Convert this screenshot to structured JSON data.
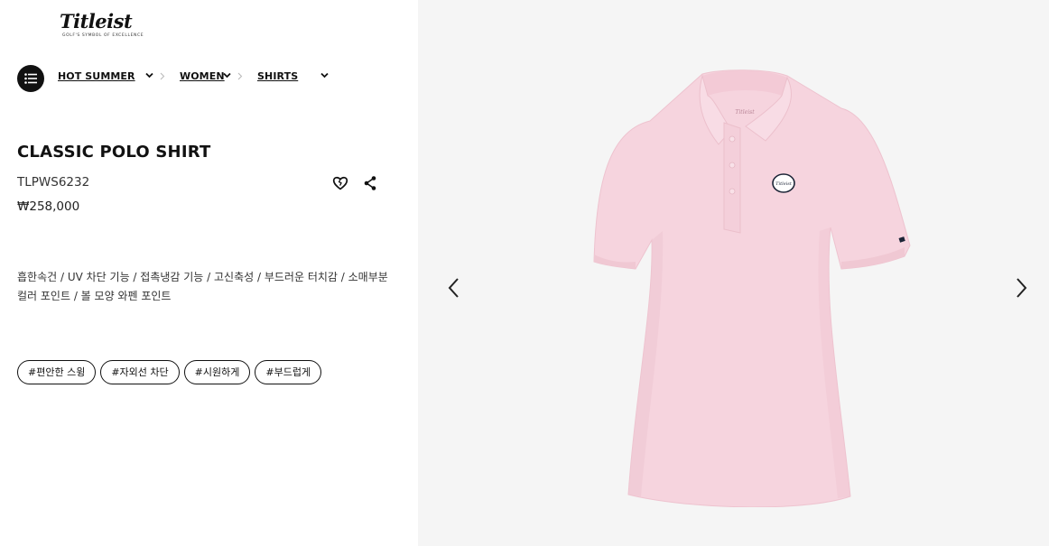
{
  "brand": {
    "logo_text": "Titleist",
    "tagline": "GOLF'S SYMBOL OF EXCELLENCE"
  },
  "breadcrumb": {
    "items": [
      {
        "label": "HOT SUMMER"
      },
      {
        "label": "WOMEN"
      },
      {
        "label": "SHIRTS"
      }
    ]
  },
  "product": {
    "title": "CLASSIC POLO SHIRT",
    "sku": "TLPWS6232",
    "price": "₩258,000",
    "description_line1": "흡한속건 / UV 차단 기능 / 접촉냉감 기능 / 고신축성 / 부드러운 터치감 / 소매부분",
    "description_line2": "컬러 포인트 / 볼 모양 와펜 포인트",
    "tags": [
      "#편안한 스윙",
      "#자외선 차단",
      "#시원하게",
      "#부드럽게"
    ],
    "color": "#f7d6e0"
  },
  "gallery": {
    "background": "#f5f5f5",
    "patch_text": "Titleist"
  },
  "icons": {
    "menu": "list-menu-icon",
    "wishlist": "heart-icon",
    "share": "share-icon",
    "prev": "chevron-left-icon",
    "next": "chevron-right-icon"
  }
}
